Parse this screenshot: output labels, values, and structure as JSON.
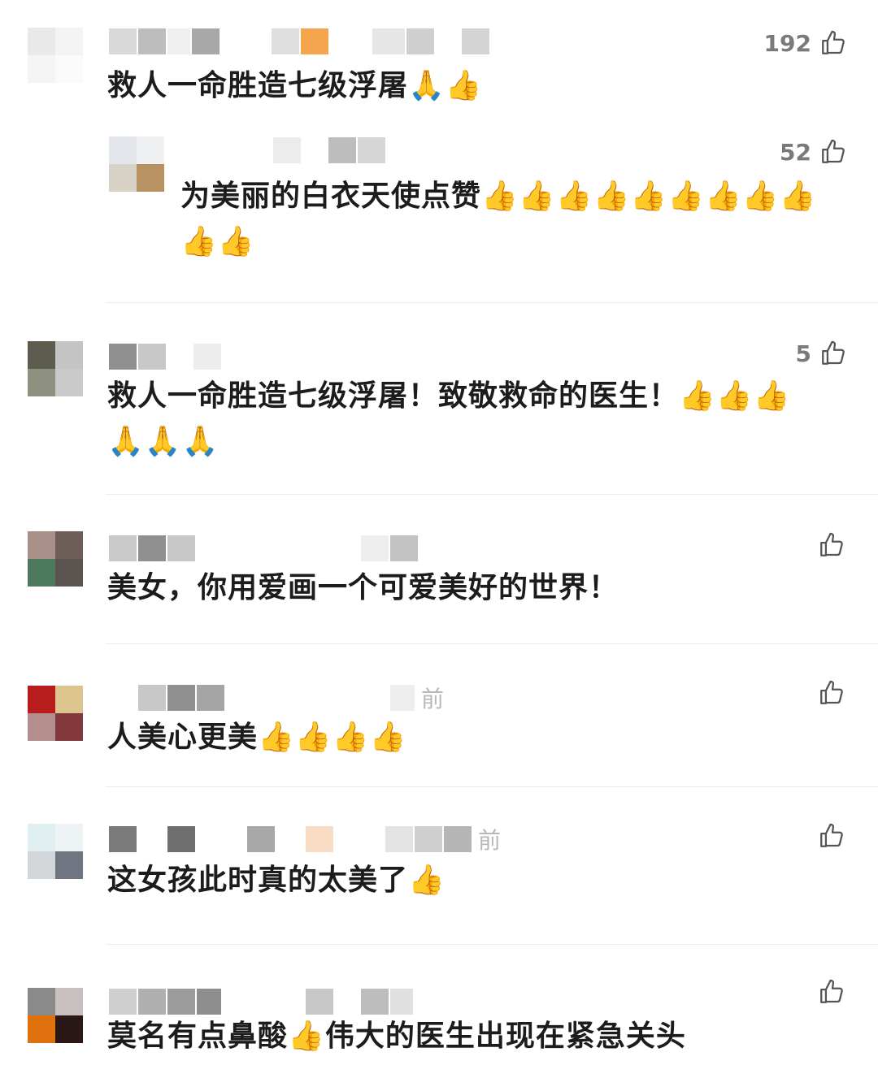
{
  "comments": [
    {
      "likes": "192",
      "text": "救人一命胜造七级浮屠🙏👍",
      "time": "",
      "replies": [
        {
          "likes": "52",
          "text": "为美丽的白衣天使点赞👍👍👍👍👍👍👍👍👍\n👍👍"
        }
      ]
    },
    {
      "likes": "5",
      "text": "救人一命胜造七级浮屠！致敬救命的医生！👍👍👍\n🙏🙏🙏",
      "time": ""
    },
    {
      "likes": "",
      "text": "美女，你用爱画一个可爱美好的世界！",
      "time": ""
    },
    {
      "likes": "",
      "text": "人美心更美👍👍👍👍",
      "time": "前"
    },
    {
      "likes": "",
      "text": "这女孩此时真的太美了👍",
      "time": "前"
    },
    {
      "likes": "",
      "text": "莫名有点鼻酸👍伟大的医生出现在紧急关头",
      "time": ""
    }
  ],
  "icons": {
    "like": "thumbs-up-outline-icon"
  },
  "colors": {
    "text": "#1c1c1c",
    "muted": "#7a7a7a",
    "divider": "#ececec"
  }
}
